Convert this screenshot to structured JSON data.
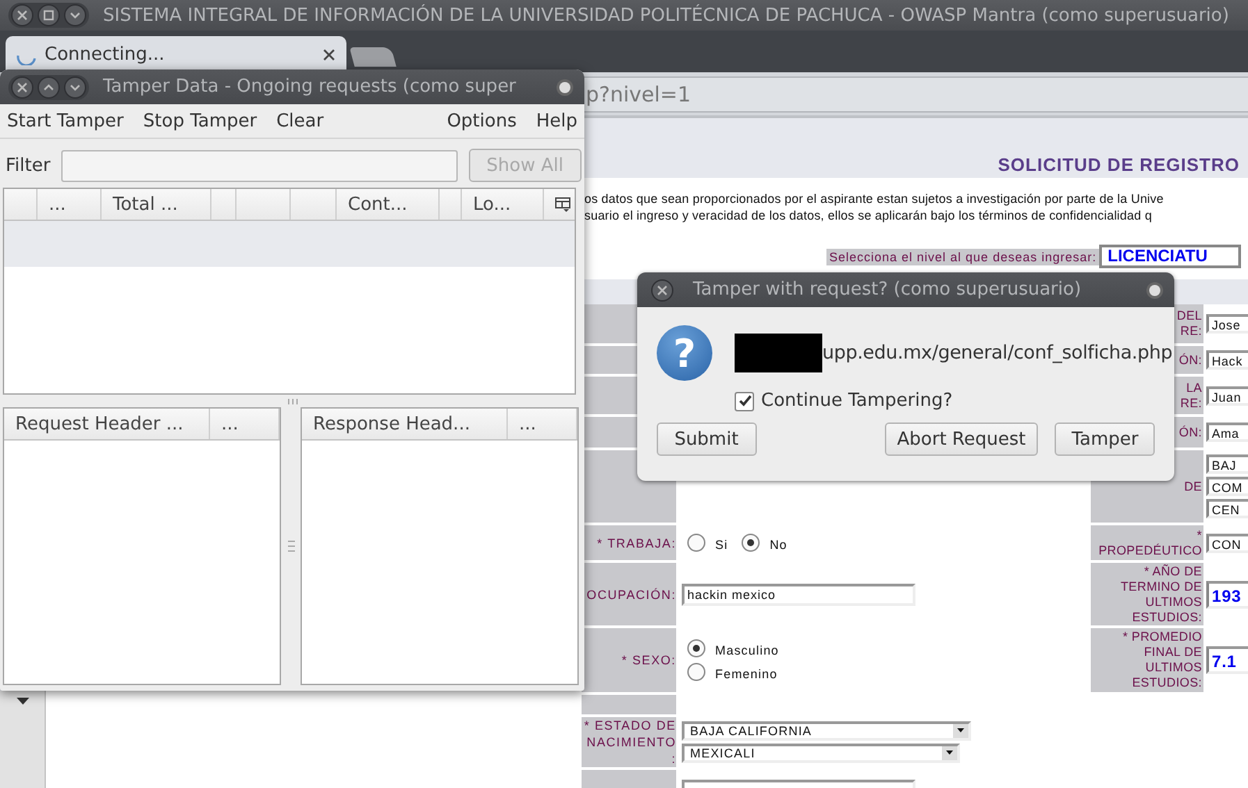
{
  "browser": {
    "title": "SISTEMA INTEGRAL DE INFORMACIÓN DE LA UNIVERSIDAD POLITÉCNICA DE PACHUCA - OWASP Mantra (como superusuario)",
    "tabs": [
      {
        "label": "Connecting...",
        "selected": true,
        "loading": true
      }
    ],
    "address": "p?nivel=1"
  },
  "page": {
    "heading": "SOLICITUD DE REGISTRO",
    "notice": [
      "os datos que sean proporcionados por el aspirante estan sujetos a investigación por parte de la Unive",
      "suario el ingreso y veracidad de los datos, ellos se aplicarán bajo los términos de confidencialidad q"
    ],
    "level_prompt": "Selecciona el nivel al que deseas ingresar:",
    "level_value": "LICENCIATU",
    "rows": [
      {
        "right": {
          "label": "DEL\nRE:",
          "kind": "text",
          "values": [
            "Jose"
          ]
        }
      },
      {
        "right": {
          "label": "ÓN:",
          "kind": "text",
          "values": [
            "Hack"
          ]
        }
      },
      {
        "right": {
          "label": "LA\nRE:",
          "kind": "text",
          "values": [
            "Juan"
          ]
        }
      },
      {
        "right": {
          "label": "ÓN:",
          "kind": "text",
          "values": [
            "Ama"
          ]
        }
      },
      {
        "right": {
          "label": "DE",
          "kind": "text",
          "values": [
            "BAJ",
            "COM",
            "CEN"
          ]
        }
      },
      {
        "left": {
          "label": "* TRABAJA:",
          "kind": "radio-inline",
          "options": [
            {
              "label": "Si",
              "selected": false
            },
            {
              "label": "No",
              "selected": true
            }
          ]
        },
        "right": {
          "label": "*\nPROPEDÉUTICO",
          "kind": "text",
          "values": [
            "CON"
          ]
        }
      },
      {
        "left": {
          "label": "OCUPACIÓN:",
          "kind": "text",
          "value": "hackin mexico"
        },
        "right": {
          "label": "* AÑO DE\nTERMINO DE\nULTIMOS\nESTUDIOS:",
          "kind": "bold",
          "values": [
            "193"
          ]
        }
      },
      {
        "left": {
          "label": "* SEXO:",
          "kind": "radio",
          "options": [
            {
              "label": "Masculino",
              "selected": true
            },
            {
              "label": "Femenino",
              "selected": false
            }
          ]
        },
        "right": {
          "label": "* PROMEDIO\nFINAL DE\nULTIMOS\nESTUDIOS:",
          "kind": "bold",
          "values": [
            "7.1"
          ]
        }
      },
      {},
      {
        "left": {
          "label": "* ESTADO DE\nNACIMIENTO\n:",
          "kind": "select",
          "values": [
            "BAJA CALIFORNIA",
            "MEXICALI"
          ]
        }
      },
      {
        "left": {
          "kind": "text"
        }
      }
    ]
  },
  "tamper_window": {
    "title": "Tamper Data - Ongoing requests (como super",
    "menu_left": [
      "Start Tamper",
      "Stop Tamper",
      "Clear"
    ],
    "menu_right": [
      "Options",
      "Help"
    ],
    "filter_label": "Filter",
    "show_all": {
      "label": "Show All",
      "disabled": true
    },
    "columns": [
      {},
      {
        "label": "..."
      },
      {
        "label": "Total ..."
      },
      {},
      {},
      {},
      {
        "label": "Cont..."
      },
      {},
      {
        "label": "Lo..."
      }
    ],
    "request_columns": [
      "Request Header ...",
      "..."
    ],
    "response_columns": [
      "Response Head...",
      "..."
    ]
  },
  "dialog": {
    "title": "Tamper with request? (como superusuario)",
    "icon": "?",
    "url": "upp.edu.mx/general/conf_solficha.php",
    "continue": {
      "label": "Continue Tampering?",
      "checked": true
    },
    "buttons": [
      "Submit",
      "Abort Request",
      "Tamper"
    ]
  }
}
